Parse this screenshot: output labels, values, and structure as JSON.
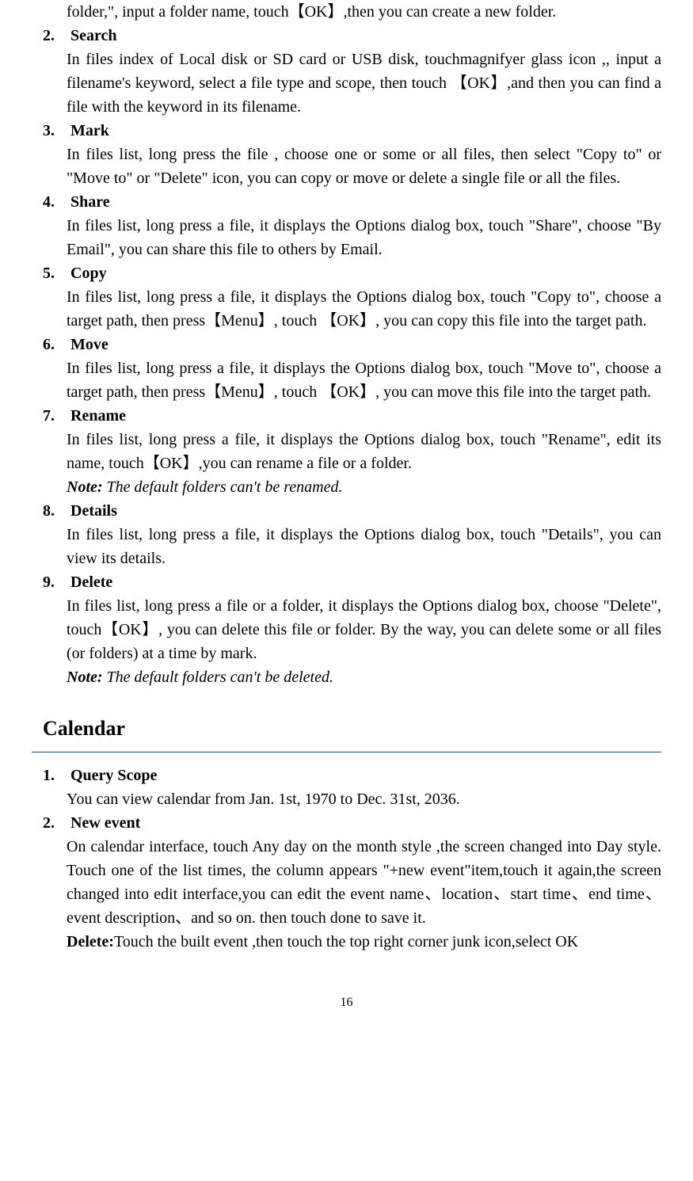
{
  "items": {
    "top_fragment": "folder,\", input a folder name, touch【OK】,then you can create a new folder.",
    "search": {
      "num": "2.",
      "title": "Search",
      "body": "In files index of Local disk or SD card or USB disk, touchmagnifyer glass icon ,, input a filename's keyword, select a file type and scope, then touch 【OK】,and then you can find a file with the keyword in its filename."
    },
    "mark": {
      "num": "3.",
      "title": "Mark",
      "body": "In files list, long press the file , choose one or some or all files, then select \"Copy to\" or \"Move to\" or \"Delete\" icon, you can copy or move or delete a single file or all the files."
    },
    "share": {
      "num": "4.",
      "title": "Share",
      "body": "In files list, long press a file, it displays the Options dialog box, touch \"Share\", choose \"By Email\", you can share this file to others by Email."
    },
    "copy": {
      "num": "5.",
      "title": "Copy",
      "body": "In files list, long press a file, it displays the Options dialog box, touch \"Copy to\", choose a target path, then press【Menu】, touch 【OK】,  you can copy this file into the target path."
    },
    "move": {
      "num": "6.",
      "title": "Move",
      "body": "In files list, long press a file, it displays the Options dialog box, touch \"Move to\", choose a target path, then press【Menu】, touch 【OK】,  you can move this file into the target path."
    },
    "rename": {
      "num": "7.",
      "title": "Rename",
      "body": "In files list, long press a file, it displays the Options dialog box, touch \"Rename\", edit its name, touch【OK】,you can rename a file or a folder.",
      "note_label": "Note:",
      "note": " The default folders can't be renamed."
    },
    "details": {
      "num": "8.",
      "title": "Details",
      "body": "In files list, long press a file, it displays the Options dialog box, touch \"Details\", you can view its details."
    },
    "delete": {
      "num": "9.",
      "title": "Delete",
      "body": "In files list, long press a file or a folder, it displays the Options dialog box, choose \"Delete\", touch【OK】, you can delete this file or folder. By the way, you can delete some or all files (or folders) at a time by mark.",
      "note_label": "Note:",
      "note": " The default folders can't be deleted."
    }
  },
  "calendar": {
    "title": "Calendar",
    "query_scope": {
      "num": "1.",
      "title": "Query Scope",
      "body": "You can view calendar from Jan. 1st, 1970 to Dec. 31st, 2036."
    },
    "new_event": {
      "num": "2.",
      "title": "New event",
      "body": "On calendar interface, touch Any day on the month style ,the screen changed into Day style. Touch one of the list times, the column appears \"+new event\"item,touch it again,the screen changed into edit interface,you can edit the event name、location、start time、end time、event description、and so on.  then touch done to save it.",
      "delete_label": "Delete:",
      "delete_body": "Touch the built event ,then touch the top right corner junk icon,select OK"
    }
  },
  "page_number": "16"
}
